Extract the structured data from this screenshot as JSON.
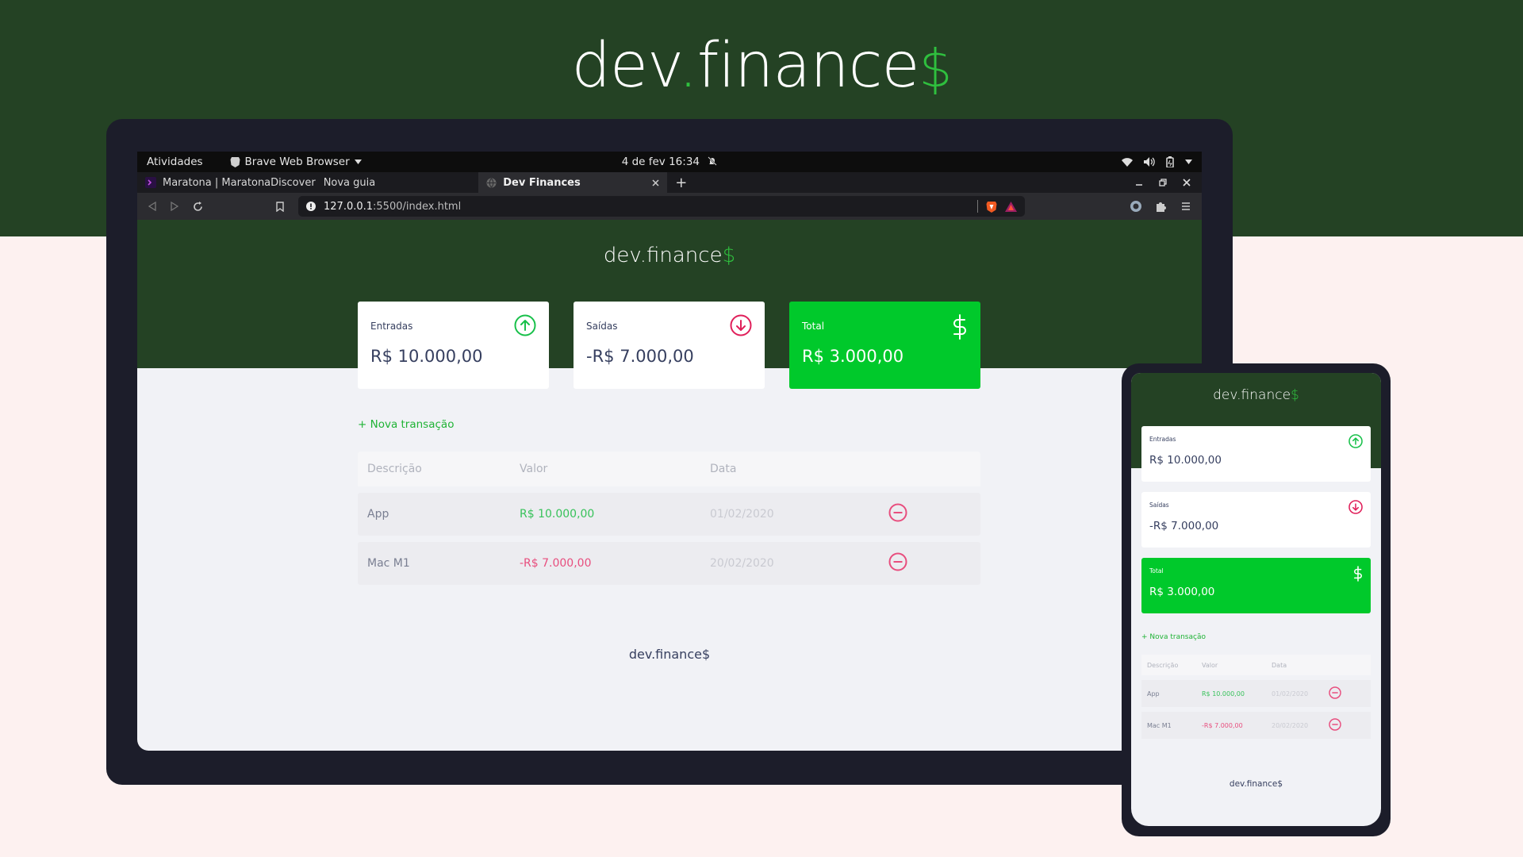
{
  "brand": {
    "name": "dev",
    "dot": ".",
    "rest": "finance",
    "currency": "$"
  },
  "os": {
    "activities": "Atividades",
    "app_name": "Brave Web Browser",
    "clock": "4 de fev  16:34"
  },
  "browser": {
    "tabs": [
      {
        "label": "Maratona | MaratonaDiscover"
      },
      {
        "label": "Nova guia"
      },
      {
        "label": "Dev Finances"
      }
    ],
    "new_tab": "+",
    "url_host": "127.0.0.1",
    "url_path": ":5500/index.html"
  },
  "app": {
    "logo": {
      "name": "dev",
      "dot": ".",
      "rest": "finance",
      "currency": "$"
    },
    "cards": {
      "income": {
        "label": "Entradas",
        "value": "R$ 10.000,00"
      },
      "expense": {
        "label": "Saídas",
        "value": "-R$ 7.000,00"
      },
      "total": {
        "label": "Total",
        "value": "R$ 3.000,00"
      }
    },
    "new_transaction": "+ Nova transação",
    "table": {
      "headers": [
        "Descrição",
        "Valor",
        "Data"
      ],
      "rows": [
        {
          "description": "App",
          "amount": "R$ 10.000,00",
          "date": "01/02/2020",
          "type": "income"
        },
        {
          "description": "Mac M1",
          "amount": "-R$ 7.000,00",
          "date": "20/02/2020",
          "type": "expense"
        }
      ]
    },
    "footer": "dev.finance$"
  },
  "colors": {
    "header_green": "#244224",
    "accent_green": "#00c92b",
    "income": "#37c25a",
    "expense": "#e84e7e"
  }
}
